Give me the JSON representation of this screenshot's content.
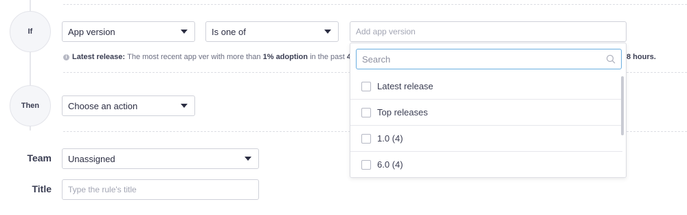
{
  "steps": {
    "if_label": "If",
    "then_label": "Then"
  },
  "condition": {
    "field_select": "App version",
    "operator_select": "Is one of",
    "value_placeholder": "Add app version"
  },
  "hint": {
    "term": "Latest release:",
    "text_1": "The most recent app ver with more than",
    "bold_1": "1% adoption",
    "text_2": "in the past",
    "bold_2": "4",
    "tail": "8 hours."
  },
  "action": {
    "select": "Choose an action"
  },
  "team": {
    "label": "Team",
    "select": "Unassigned"
  },
  "title_field": {
    "label": "Title",
    "placeholder": "Type the rule's title"
  },
  "dropdown": {
    "search_placeholder": "Search",
    "options": [
      {
        "label": "Latest release",
        "checked": false
      },
      {
        "label": "Top releases",
        "checked": false
      },
      {
        "label": "1.0 (4)",
        "checked": false
      },
      {
        "label": "6.0 (4)",
        "checked": false
      }
    ]
  }
}
